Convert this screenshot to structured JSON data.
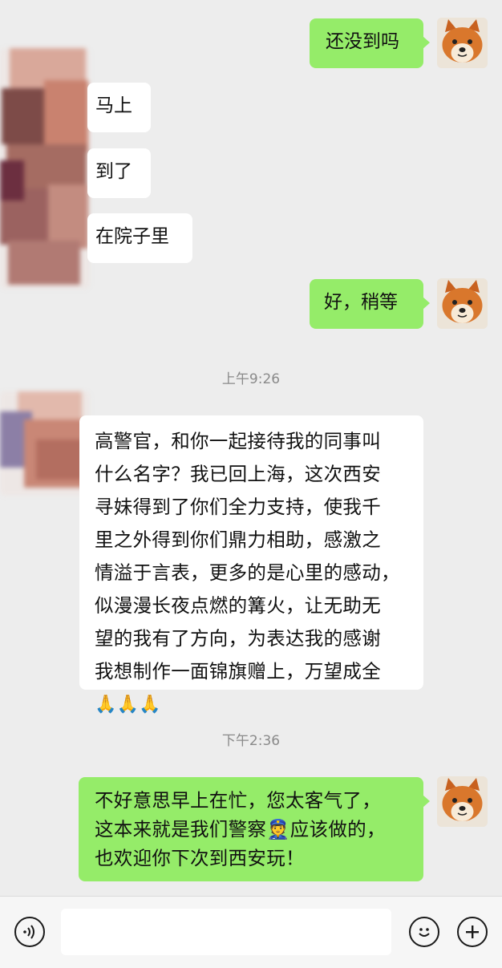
{
  "messages": [
    {
      "id": 1,
      "side": "out",
      "text": "还没到吗"
    },
    {
      "id": 2,
      "side": "in",
      "text": "马上"
    },
    {
      "id": 3,
      "side": "in",
      "text": "到了"
    },
    {
      "id": 4,
      "side": "in",
      "text": "在院子里"
    },
    {
      "id": 5,
      "side": "out",
      "text": "好，稍等"
    },
    {
      "id": 6,
      "side": "in",
      "lines": [
        "高警官，和你一起接待我的同事叫",
        "什么名字？我已回上海，这次西安",
        "寻妹得到了你们全力支持，使我千",
        "里之外得到你们鼎力相助，感激之",
        "情溢于言表，更多的是心里的感动，",
        "似漫漫长夜点燃的篝火，让无助无",
        "望的我有了方向，为表达我的感谢",
        "我想制作一面锦旗赠上，万望成全",
        "🙏🙏🙏"
      ]
    },
    {
      "id": 7,
      "side": "out",
      "lines": [
        "不好意思早上在忙，您太客气了，",
        "这本来就是我们警察👮应该做的，",
        "也欢迎你下次到西安玩！"
      ]
    }
  ],
  "timestamps": [
    "上午9:26",
    "下午2:36"
  ],
  "input_bar": {
    "icons": [
      "voice-icon",
      "emoji-icon",
      "plus-icon"
    ]
  },
  "colors": {
    "background": "#ededed",
    "outgoing_bubble": "#95ec69",
    "incoming_bubble": "#ffffff",
    "timestamp_text": "#8a8a8a"
  }
}
